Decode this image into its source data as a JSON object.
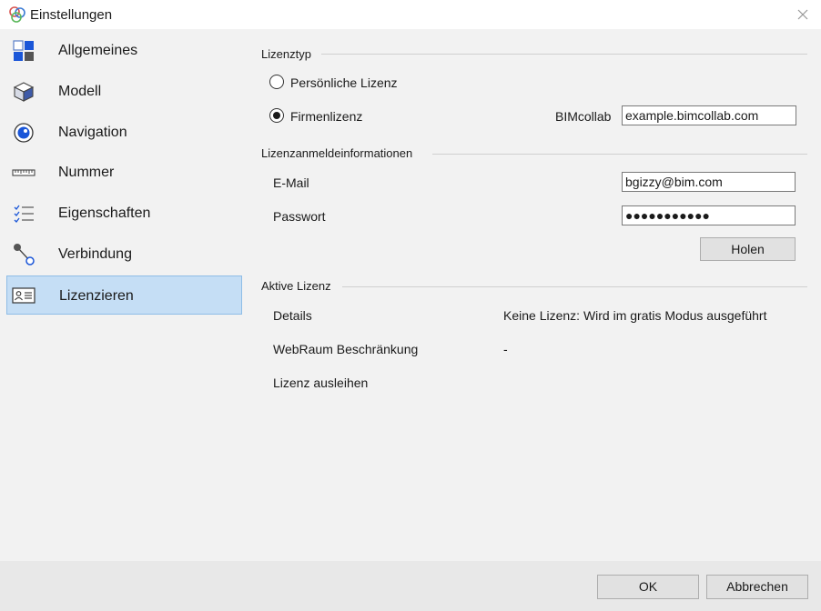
{
  "window": {
    "title": "Einstellungen",
    "app_icon": "bimcollab-logo-icon",
    "close_icon": "close-icon"
  },
  "sidebar": {
    "items": [
      {
        "label": "Allgemeines",
        "icon": "general-tiles-icon",
        "selected": false
      },
      {
        "label": "Modell",
        "icon": "cube-icon",
        "selected": false
      },
      {
        "label": "Navigation",
        "icon": "eye-target-icon",
        "selected": false
      },
      {
        "label": "Nummer",
        "icon": "ruler-icon",
        "selected": false
      },
      {
        "label": "Eigenschaften",
        "icon": "checklist-icon",
        "selected": false
      },
      {
        "label": "Verbindung",
        "icon": "connection-node-icon",
        "selected": false
      },
      {
        "label": "Lizenzieren",
        "icon": "id-card-icon",
        "selected": true
      }
    ]
  },
  "license_type": {
    "heading": "Lizenztyp",
    "personal_label": "Persönliche Lizenz",
    "company_label": "Firmenlizenz",
    "selected": "Firmenlizenz",
    "bimcollab_label": "BIMcollab",
    "bimcollab_value": "example.bimcollab.com"
  },
  "credentials": {
    "heading": "Lizenzanmeldeinformationen",
    "email_label": "E-Mail",
    "email_value": "bgizzy@bim.com",
    "password_label": "Passwort",
    "password_masked": "●●●●●●●●●●●",
    "fetch_button": "Holen"
  },
  "active_license": {
    "heading": "Aktive Lizenz",
    "details_label": "Details",
    "details_value": "Keine Lizenz: Wird im gratis Modus ausgeführt",
    "webroom_label": "WebRaum Beschränkung",
    "webroom_value": "-",
    "borrow_label": "Lizenz ausleihen"
  },
  "footer": {
    "ok_label": "OK",
    "cancel_label": "Abbrechen"
  },
  "colors": {
    "selected_bg": "#c5def5",
    "selected_border": "#8fbde6",
    "panel_bg": "#f2f2f2",
    "accent_blue": "#1a56d8"
  }
}
